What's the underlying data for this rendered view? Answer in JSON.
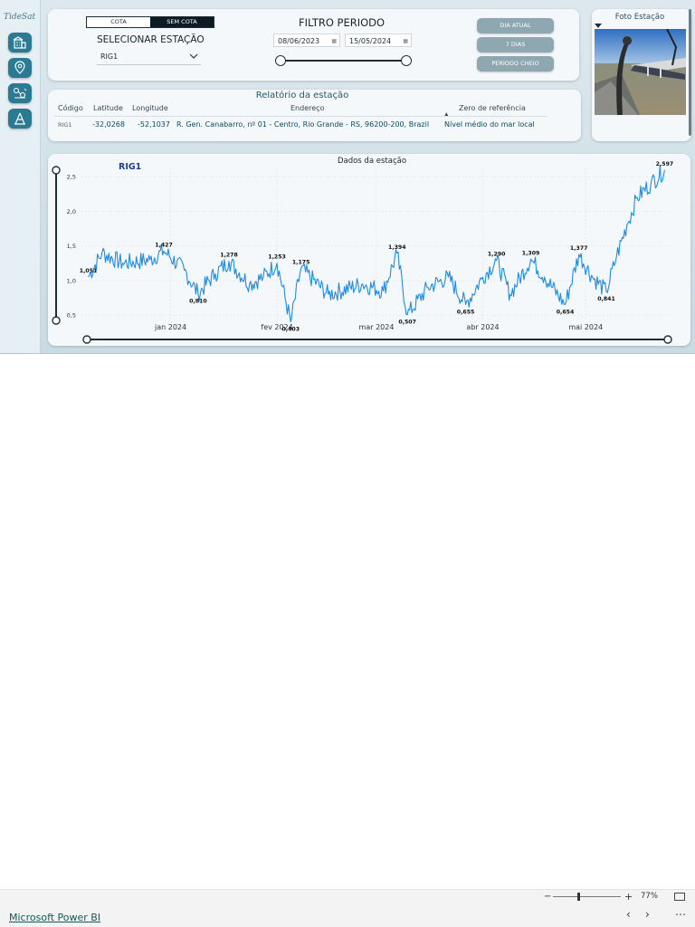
{
  "app": {
    "logo": "TideSat",
    "brand": "Microsoft Power BI"
  },
  "sidebar": {
    "items": [
      {
        "icon": "building-icon"
      },
      {
        "icon": "map-pin-icon"
      },
      {
        "icon": "data-icon"
      },
      {
        "icon": "tower-icon"
      }
    ]
  },
  "filters": {
    "mode_toggle": {
      "options": [
        "COTA",
        "SEM COTA"
      ],
      "selected": "SEM COTA"
    },
    "station_label": "SELECIONAR ESTAÇÃO",
    "station_value": "RIG1",
    "period_title": "FILTRO PERIODO",
    "start_date": "08/06/2023",
    "end_date": "15/05/2024",
    "period_range_fraction": [
      0.0,
      1.0
    ],
    "buttons": [
      "DIA ATUAL",
      "7 DIAS",
      "PERÍODO CHEIO"
    ]
  },
  "photo": {
    "title": "Foto Estação"
  },
  "report": {
    "title": "Relatório da estação",
    "columns": [
      "Código",
      "Latitude",
      "Longitude",
      "Endereço",
      "Zero de referência"
    ],
    "row": {
      "code": "RIG1",
      "latitude": "-32,0268",
      "longitude": "-52,1037",
      "address": "R. Gen. Canabarro, nº 01 - Centro, Rio Grande - RS, 96200-200, Brazil",
      "reference": "Nível médio do mar local"
    }
  },
  "chart_data": {
    "type": "line",
    "title": "Dados da estação",
    "station": "RIG1",
    "color": "#1e8be5",
    "ylim": [
      0.45,
      2.62
    ],
    "yticks": [
      "0,5",
      "1,0",
      "1,5",
      "2,0",
      "2,5"
    ],
    "xticks": [
      "jan 2024",
      "fev 2024",
      "mar 2024",
      "abr 2024",
      "mai 2024"
    ],
    "anchors": [
      [
        "2023-12-08",
        1.051
      ],
      [
        "2023-12-12",
        1.4
      ],
      [
        "2023-12-18",
        1.25
      ],
      [
        "2023-12-26",
        1.3
      ],
      [
        "2023-12-30",
        1.427
      ],
      [
        "2024-01-05",
        1.15
      ],
      [
        "2024-01-09",
        0.81
      ],
      [
        "2024-01-14",
        1.1
      ],
      [
        "2024-01-18",
        1.278
      ],
      [
        "2024-01-24",
        0.95
      ],
      [
        "2024-01-28",
        1.05
      ],
      [
        "2024-02-01",
        1.253
      ],
      [
        "2024-02-05",
        0.403
      ],
      [
        "2024-02-08",
        1.175
      ],
      [
        "2024-02-16",
        0.8
      ],
      [
        "2024-02-26",
        0.95
      ],
      [
        "2024-03-03",
        0.85
      ],
      [
        "2024-03-07",
        1.394
      ],
      [
        "2024-03-10",
        0.507
      ],
      [
        "2024-03-16",
        0.9
      ],
      [
        "2024-03-22",
        1.05
      ],
      [
        "2024-03-27",
        0.655
      ],
      [
        "2024-04-01",
        1.05
      ],
      [
        "2024-04-05",
        1.29
      ],
      [
        "2024-04-09",
        0.8
      ],
      [
        "2024-04-15",
        1.309
      ],
      [
        "2024-04-19",
        1.05
      ],
      [
        "2024-04-25",
        0.654
      ],
      [
        "2024-04-29",
        1.377
      ],
      [
        "2024-05-03",
        1.05
      ],
      [
        "2024-05-07",
        0.841
      ],
      [
        "2024-05-10",
        1.35
      ],
      [
        "2024-05-13",
        1.8
      ],
      [
        "2024-05-16",
        2.2
      ],
      [
        "2024-05-20",
        2.4
      ],
      [
        "2024-05-24",
        2.597
      ]
    ],
    "data_labels": [
      {
        "x": "2023-12-08",
        "y": 1.051,
        "text": "1,051",
        "pos": "above"
      },
      {
        "x": "2023-12-30",
        "y": 1.427,
        "text": "1,427",
        "pos": "above"
      },
      {
        "x": "2024-01-09",
        "y": 0.81,
        "text": "0,810",
        "pos": "below"
      },
      {
        "x": "2024-01-18",
        "y": 1.278,
        "text": "1,278",
        "pos": "above"
      },
      {
        "x": "2024-02-01",
        "y": 1.253,
        "text": "1,253",
        "pos": "above"
      },
      {
        "x": "2024-02-05",
        "y": 0.403,
        "text": "0,403",
        "pos": "below"
      },
      {
        "x": "2024-02-08",
        "y": 1.175,
        "text": "1,175",
        "pos": "above"
      },
      {
        "x": "2024-03-07",
        "y": 1.394,
        "text": "1,394",
        "pos": "above"
      },
      {
        "x": "2024-03-10",
        "y": 0.507,
        "text": "0,507",
        "pos": "below"
      },
      {
        "x": "2024-03-27",
        "y": 0.655,
        "text": "0,655",
        "pos": "below"
      },
      {
        "x": "2024-04-05",
        "y": 1.29,
        "text": "1,290",
        "pos": "above"
      },
      {
        "x": "2024-04-15",
        "y": 1.309,
        "text": "1,309",
        "pos": "above"
      },
      {
        "x": "2024-04-25",
        "y": 0.654,
        "text": "0,654",
        "pos": "below"
      },
      {
        "x": "2024-04-29",
        "y": 1.377,
        "text": "1,377",
        "pos": "above"
      },
      {
        "x": "2024-05-07",
        "y": 0.841,
        "text": "0,841",
        "pos": "below"
      },
      {
        "x": "2024-05-24",
        "y": 2.597,
        "text": "2,597",
        "pos": "above"
      }
    ],
    "x_domain": [
      "2023-12-06",
      "2024-05-26"
    ],
    "grid": true
  },
  "footer": {
    "zoom": "77%"
  }
}
